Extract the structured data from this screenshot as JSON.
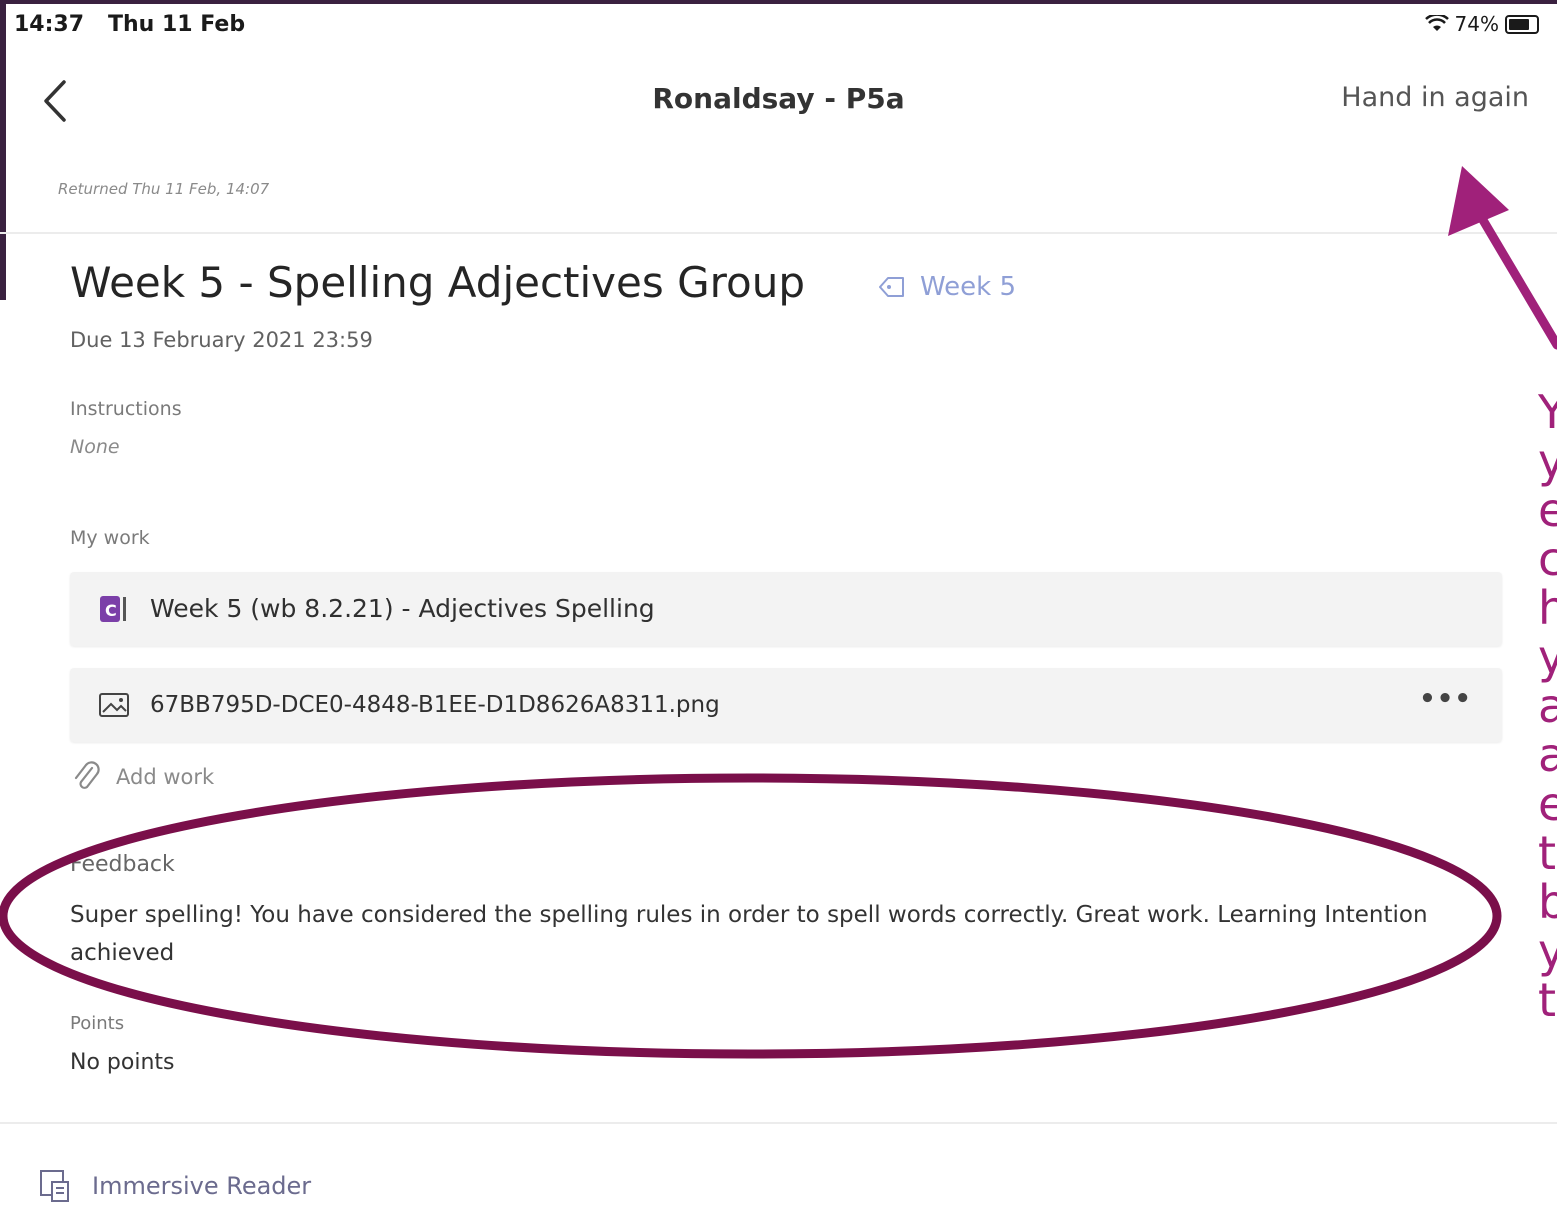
{
  "status_bar": {
    "time": "14:37",
    "date": "Thu 11 Feb",
    "battery": "74%",
    "wifi_icon": "wifi-icon",
    "battery_icon": "battery-icon"
  },
  "header": {
    "back_icon": "chevron-left-icon",
    "title": "Ronaldsay - P5a",
    "hand_in_label": "Hand in again"
  },
  "returned_note": "Returned Thu 11 Feb, 14:07",
  "assignment": {
    "title": "Week 5 - Spelling Adjectives Group",
    "tag": "Week 5",
    "due": "Due 13 February 2021 23:59",
    "instructions_label": "Instructions",
    "instructions_value": "None"
  },
  "my_work": {
    "label": "My work",
    "items": [
      {
        "name": "Week 5 (wb 8.2.21) - Adjectives Spelling",
        "icon": "onenote-icon"
      },
      {
        "name": "67BB795D-DCE0-4848-B1EE-D1D8626A8311.png",
        "icon": "image-file-icon",
        "more": "•••"
      }
    ],
    "add_work_label": "Add work"
  },
  "feedback": {
    "label": "Feedback",
    "text": "Super spelling! You have considered the spelling rules in order to spell words correctly.  Great work. Learning Intention achieved"
  },
  "points": {
    "label": "Points",
    "value": "No points"
  },
  "footer": {
    "immersive_reader": "Immersive Reader"
  },
  "annotation": {
    "side_note_letters": [
      "Y",
      "y",
      "e",
      "c",
      "h",
      "y",
      "a",
      "a",
      "e",
      "t",
      "b",
      "y",
      "t"
    ],
    "color": "#a0217a",
    "circle_color": "#7a0f4a"
  }
}
